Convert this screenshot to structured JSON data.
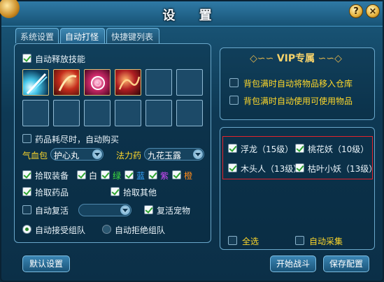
{
  "window": {
    "title": "设 置",
    "help_label": "?",
    "close_label": "×"
  },
  "tabs": [
    {
      "label": "系统设置",
      "active": false
    },
    {
      "label": "自动打怪",
      "active": true
    },
    {
      "label": "快捷键列表",
      "active": false
    }
  ],
  "left": {
    "auto_skill": {
      "label": "自动释放技能",
      "checked": true
    },
    "skills": [
      "blade-skill-icon",
      "flame-slash-skill-icon",
      "vortex-skill-icon",
      "dragon-skill-icon"
    ],
    "auto_buy": {
      "label": "药品耗尽时，自动购买",
      "checked": false
    },
    "hp_label": "气血包",
    "hp_value": "护心丸",
    "mp_label": "法力药",
    "mp_value": "九花玉露",
    "pick_equip": {
      "label": "拾取装备",
      "checked": true
    },
    "colors": [
      {
        "label": "白",
        "color": "#ffffff",
        "checked": true
      },
      {
        "label": "绿",
        "color": "#3ee03e",
        "checked": true
      },
      {
        "label": "蓝",
        "color": "#35a4ff",
        "checked": true
      },
      {
        "label": "紫",
        "color": "#d44bff",
        "checked": true
      },
      {
        "label": "橙",
        "color": "#ff8a1a",
        "checked": true
      }
    ],
    "pick_drug": {
      "label": "拾取药品",
      "checked": true
    },
    "pick_other": {
      "label": "拾取其他",
      "checked": true
    },
    "auto_revive": {
      "label": "自动复活",
      "checked": false
    },
    "revive_value": "",
    "revive_pet": {
      "label": "复活宠物",
      "checked": true
    },
    "accept_team": {
      "label": "自动接受组队",
      "selected": true
    },
    "reject_team": {
      "label": "自动拒绝组队",
      "selected": false
    }
  },
  "right": {
    "vip_title": "VIP专属",
    "vip_opts": [
      {
        "label": "背包满时自动将物品移入仓库",
        "checked": false
      },
      {
        "label": "背包满时自动使用可使用物品",
        "checked": false
      }
    ],
    "monsters": [
      {
        "label": "浮龙（15级）",
        "checked": true
      },
      {
        "label": "桃花妖（10级）",
        "checked": true
      },
      {
        "label": "木头人（13级）",
        "checked": true
      },
      {
        "label": "枯叶小妖（13级）",
        "checked": true
      }
    ],
    "select_all": {
      "label": "全选",
      "checked": false
    },
    "auto_gather": {
      "label": "自动采集",
      "checked": false
    }
  },
  "buttons": {
    "default": "默认设置",
    "start": "开始战斗",
    "save": "保存配置"
  },
  "colors": {
    "accent_yellow": "#ffd82a",
    "highlight_red": "#e3232c",
    "panel_bg": "#0e3954"
  }
}
